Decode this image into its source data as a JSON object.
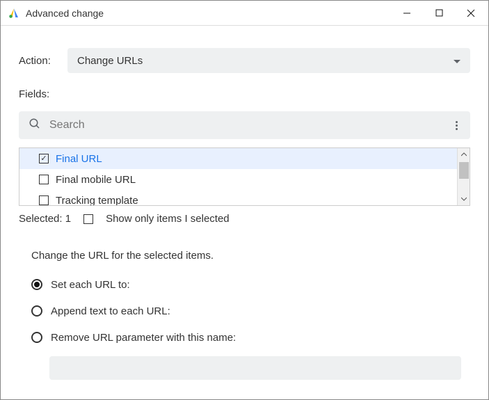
{
  "window": {
    "title": "Advanced change"
  },
  "action": {
    "label": "Action:",
    "value": "Change URLs"
  },
  "fields": {
    "label": "Fields:",
    "search_placeholder": "Search",
    "items": [
      {
        "label": "Final URL",
        "checked": true,
        "selected": true
      },
      {
        "label": "Final mobile URL",
        "checked": false,
        "selected": false
      },
      {
        "label": "Tracking template",
        "checked": false,
        "selected": false
      }
    ]
  },
  "selected": {
    "text": "Selected: 1",
    "show_only_label": "Show only items I selected"
  },
  "instruction": "Change the URL for the selected items.",
  "radios": {
    "set": "Set each URL to:",
    "append": "Append text to each URL:",
    "remove": "Remove URL parameter with this name:"
  }
}
